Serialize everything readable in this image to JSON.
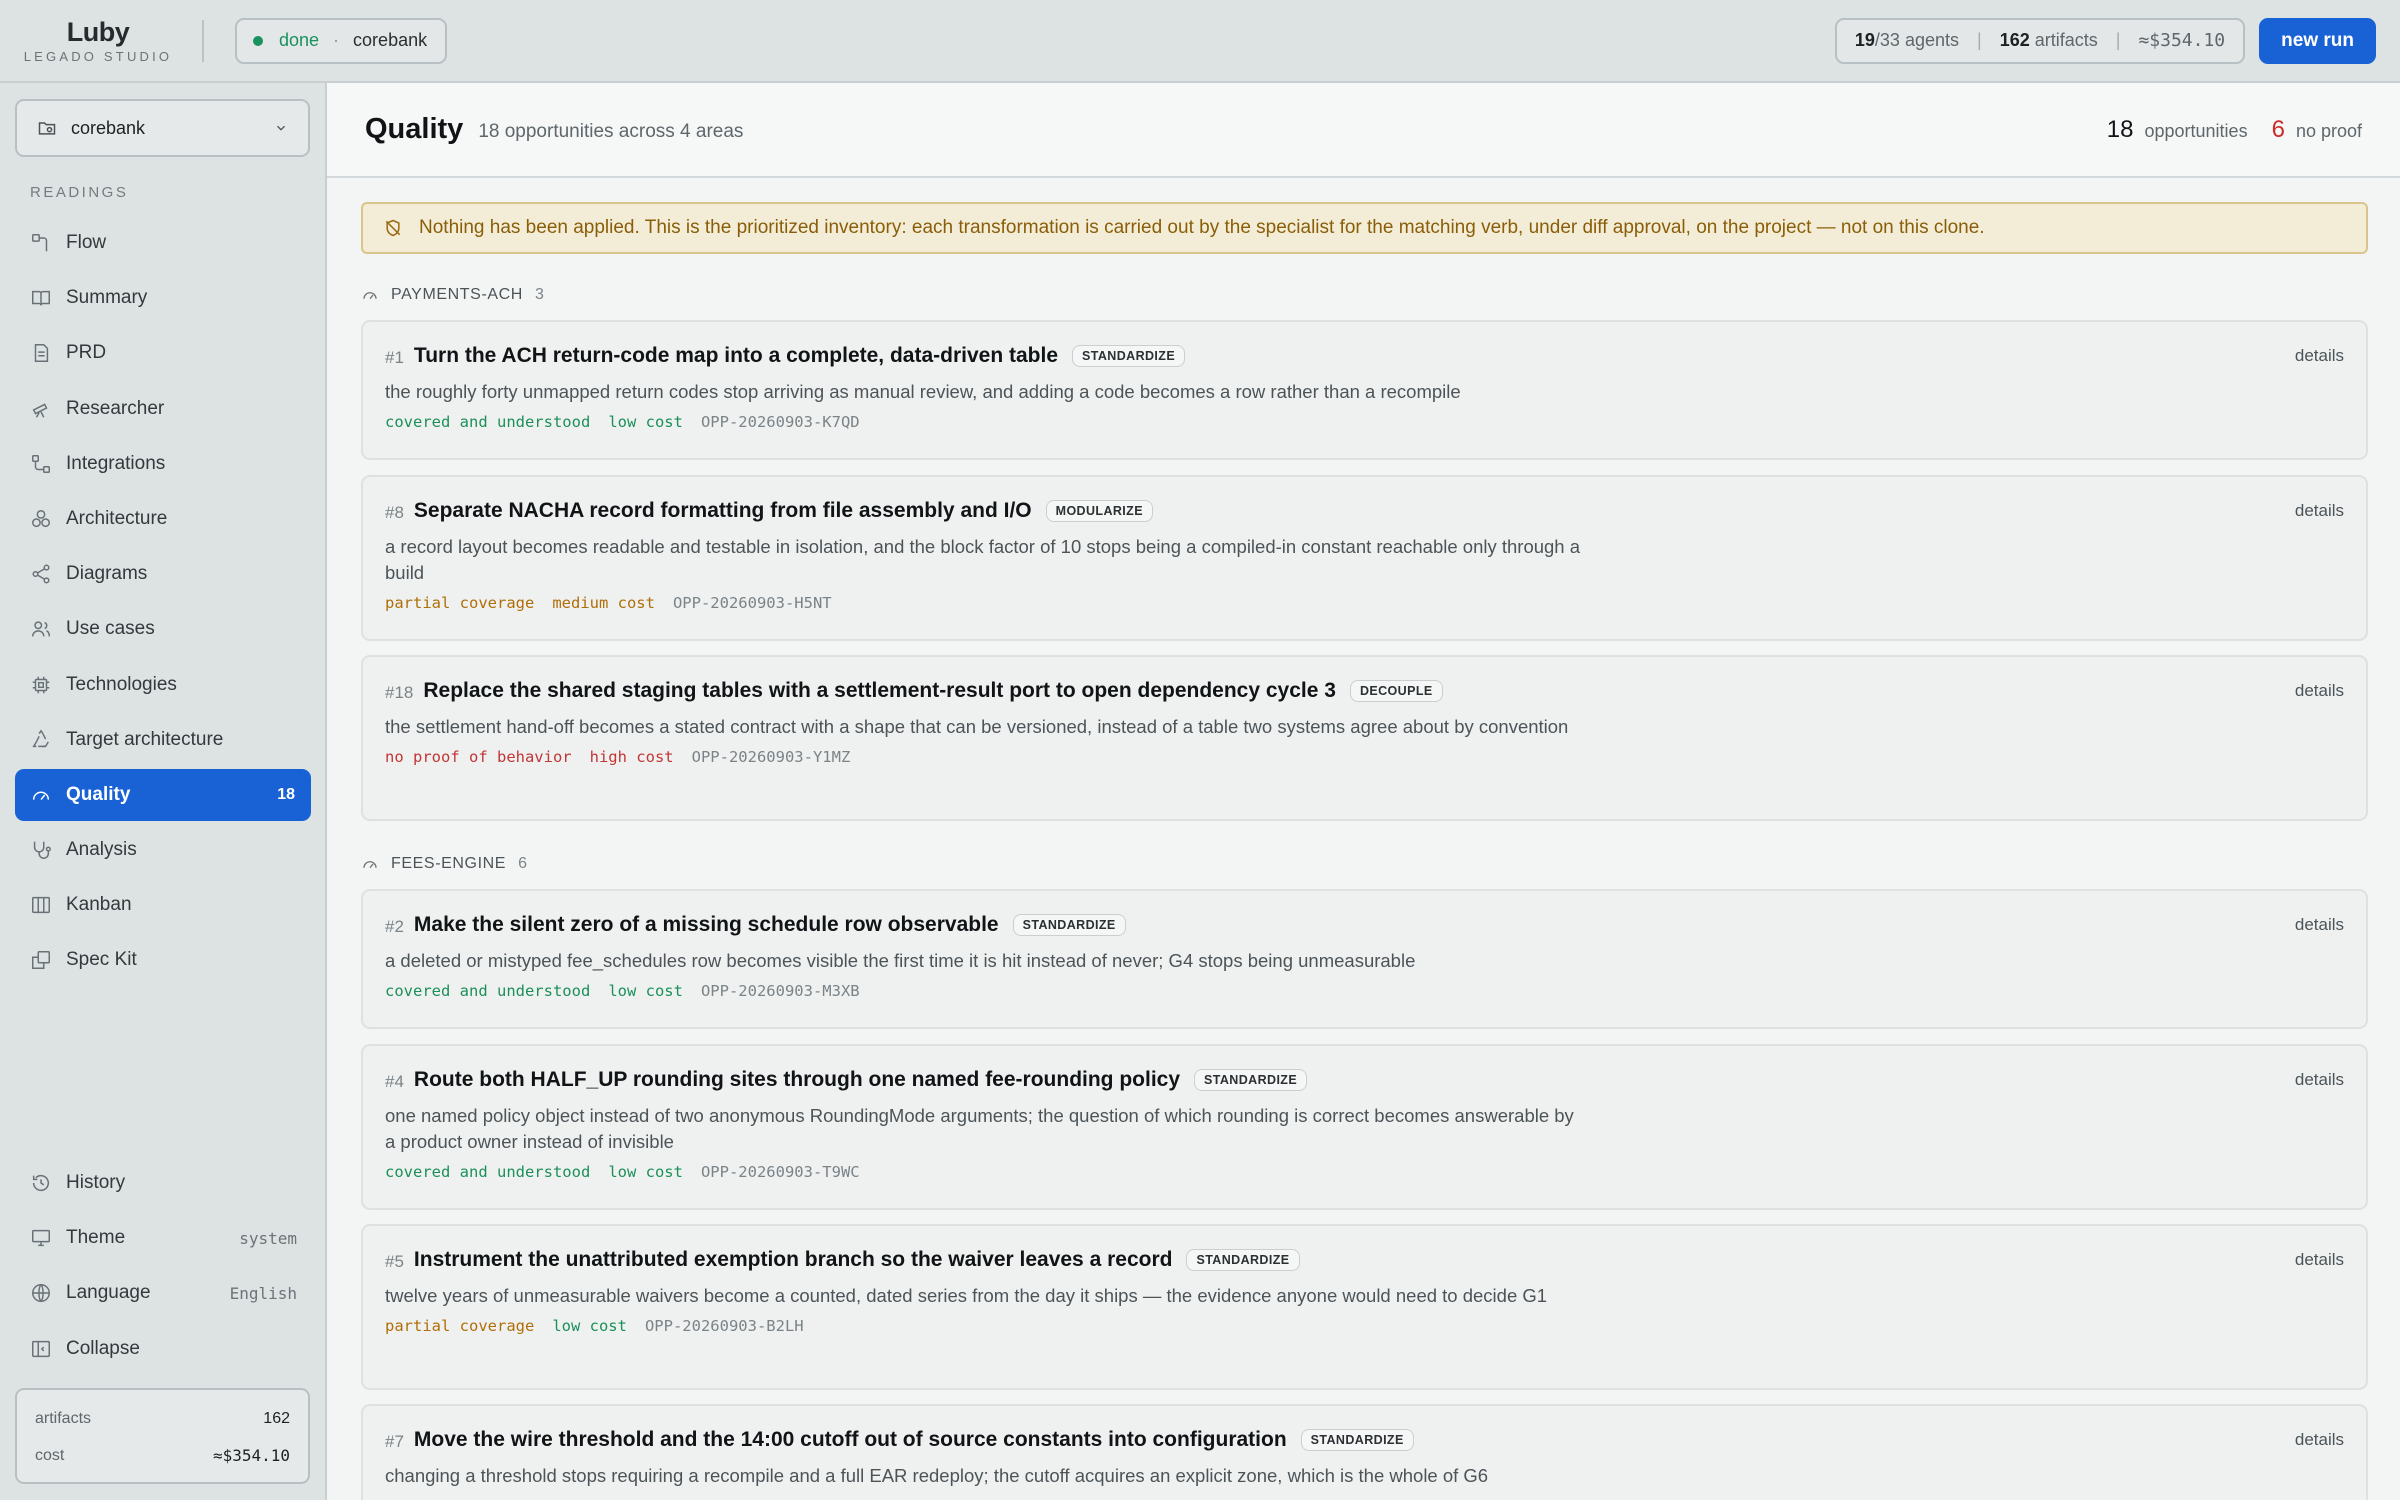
{
  "brand": {
    "logo": "Luby",
    "subtitle": "LEGADO STUDIO"
  },
  "run": {
    "status": "done",
    "separator": "·",
    "project": "corebank"
  },
  "stats": {
    "agents_done": "19",
    "agents_total": "/33 agents",
    "artifacts_num": "162",
    "artifacts_label": " artifacts",
    "cost": "≈$354.10"
  },
  "new_run_label": "new run",
  "sidebar": {
    "project": "corebank",
    "section_label": "READINGS",
    "items": [
      {
        "label": "Flow",
        "icon": "flow-icon"
      },
      {
        "label": "Summary",
        "icon": "book-icon"
      },
      {
        "label": "PRD",
        "icon": "document-icon"
      },
      {
        "label": "Researcher",
        "icon": "telescope-icon"
      },
      {
        "label": "Integrations",
        "icon": "integrations-icon"
      },
      {
        "label": "Architecture",
        "icon": "architecture-icon"
      },
      {
        "label": "Diagrams",
        "icon": "share-icon"
      },
      {
        "label": "Use cases",
        "icon": "users-icon"
      },
      {
        "label": "Technologies",
        "icon": "chip-icon"
      },
      {
        "label": "Target architecture",
        "icon": "recycle-icon"
      },
      {
        "label": "Quality",
        "icon": "gauge-icon",
        "badge": "18",
        "active": true
      },
      {
        "label": "Analysis",
        "icon": "stethoscope-icon"
      },
      {
        "label": "Kanban",
        "icon": "kanban-icon"
      },
      {
        "label": "Spec Kit",
        "icon": "speckit-icon"
      }
    ],
    "bottom": [
      {
        "label": "History",
        "icon": "history-icon"
      },
      {
        "label": "Theme",
        "icon": "monitor-icon",
        "value": "system"
      },
      {
        "label": "Language",
        "icon": "globe-icon",
        "value": "English"
      },
      {
        "label": "Collapse",
        "icon": "collapse-icon"
      }
    ],
    "summary": {
      "artifacts_label": "artifacts",
      "artifacts_value": "162",
      "cost_label": "cost",
      "cost_value": "≈$354.10"
    }
  },
  "page": {
    "title": "Quality",
    "subtitle": "18 opportunities across 4 areas",
    "opportunities_count": "18",
    "opportunities_label": "opportunities",
    "no_proof_count": "6",
    "no_proof_label": "no proof",
    "notice": "Nothing has been applied. This is the prioritized inventory: each transformation is carried out by the specialist for the matching verb, under diff approval, on the project — not on this clone."
  },
  "groups": [
    {
      "name": "PAYMENTS-ACH",
      "count": "3",
      "cards": [
        {
          "num": "#1",
          "title": "Turn the ACH return-code map into a complete, data-driven table",
          "tag": "STANDARDIZE",
          "desc": "the roughly forty unmapped return codes stop arriving as manual review, and adding a code becomes a row rather than a recompile",
          "coverage": "covered and understood",
          "coverage_color": "#1b9058",
          "cost": "low cost",
          "cost_color": "#1b9058",
          "id": "OPP-20260903-K7QD",
          "details": "details"
        },
        {
          "num": "#8",
          "title": "Separate NACHA record formatting from file assembly and I/O",
          "tag": "MODULARIZE",
          "desc": "a record layout becomes readable and testable in isolation, and the block factor of 10 stops being a compiled-in constant reachable only through a build",
          "coverage": "partial coverage",
          "coverage_color": "#b06e08",
          "cost": "medium cost",
          "cost_color": "#b06e08",
          "id": "OPP-20260903-H5NT",
          "details": "details"
        },
        {
          "num": "#18",
          "title": "Replace the shared staging tables with a settlement-result port to open dependency cycle 3",
          "tag": "DECOUPLE",
          "desc": "the settlement hand-off becomes a stated contract with a shape that can be versioned, instead of a table two systems agree about by convention",
          "coverage": "no proof of behavior",
          "coverage_color": "#c23535",
          "cost": "high cost",
          "cost_color": "#c23535",
          "id": "OPP-20260903-Y1MZ",
          "details": "details"
        }
      ]
    },
    {
      "name": "FEES-ENGINE",
      "count": "6",
      "cards": [
        {
          "num": "#2",
          "title": "Make the silent zero of a missing schedule row observable",
          "tag": "STANDARDIZE",
          "desc": "a deleted or mistyped fee_schedules row becomes visible the first time it is hit instead of never; G4 stops being unmeasurable",
          "coverage": "covered and understood",
          "coverage_color": "#1b9058",
          "cost": "low cost",
          "cost_color": "#1b9058",
          "id": "OPP-20260903-M3XB",
          "details": "details"
        },
        {
          "num": "#4",
          "title": "Route both HALF_UP rounding sites through one named fee-rounding policy",
          "tag": "STANDARDIZE",
          "desc": "one named policy object instead of two anonymous RoundingMode arguments; the question of which rounding is correct becomes answerable by a product owner instead of invisible",
          "coverage": "covered and understood",
          "coverage_color": "#1b9058",
          "cost": "low cost",
          "cost_color": "#1b9058",
          "id": "OPP-20260903-T9WC",
          "details": "details"
        },
        {
          "num": "#5",
          "title": "Instrument the unattributed exemption branch so the waiver leaves a record",
          "tag": "STANDARDIZE",
          "desc": "twelve years of unmeasurable waivers become a counted, dated series from the day it ships — the evidence anyone would need to decide G1",
          "coverage": "partial coverage",
          "coverage_color": "#b06e08",
          "cost": "low cost",
          "cost_color": "#1b9058",
          "id": "OPP-20260903-B2LH",
          "details": "details"
        },
        {
          "num": "#7",
          "title": "Move the wire threshold and the 14:00 cutoff out of source constants into configuration",
          "tag": "STANDARDIZE",
          "desc": "changing a threshold stops requiring a recompile and a full EAR redeploy; the cutoff acquires an explicit zone, which is the whole of G6",
          "coverage": "",
          "coverage_color": "#1b9058",
          "cost": "",
          "cost_color": "#1b9058",
          "id": "",
          "details": "details"
        }
      ]
    }
  ]
}
